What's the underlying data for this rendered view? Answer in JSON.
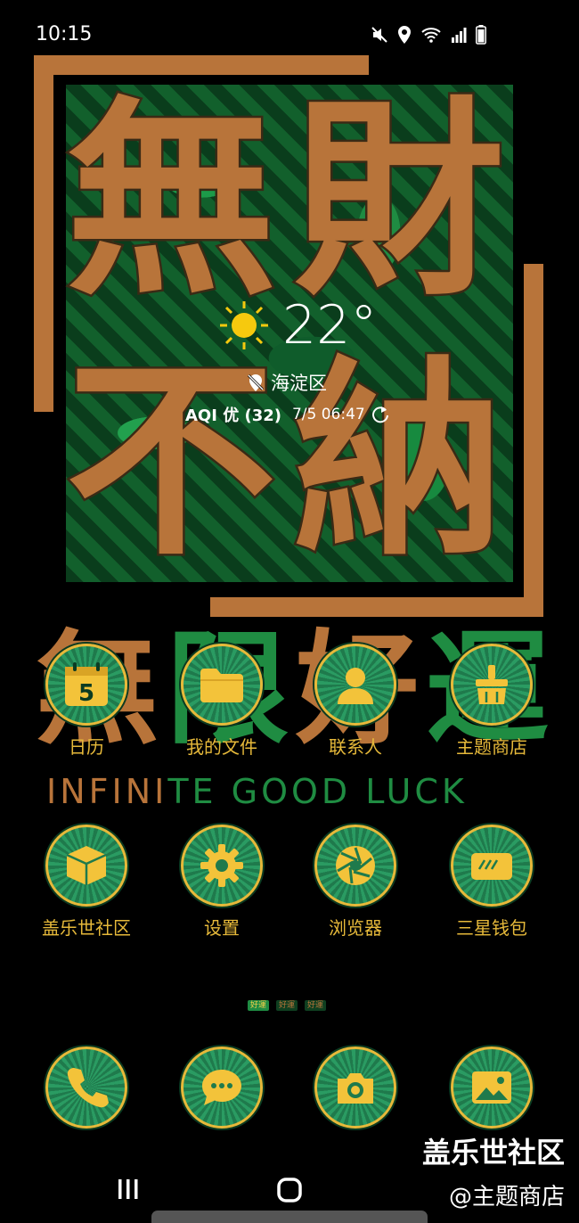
{
  "status_bar": {
    "time": "10:15",
    "icons": [
      "mute-icon",
      "location-icon",
      "wifi-icon",
      "signal-icon",
      "battery-icon"
    ]
  },
  "poster": {
    "chars": [
      "無",
      "財",
      "不",
      "納"
    ],
    "accent_color": "#b8743a",
    "leaf_color": "#1f8c42"
  },
  "weather": {
    "icon": "sun-icon",
    "temperature": "22°",
    "location": "海淀区",
    "aqi": "AQI 优 (32)",
    "updated": "7/5 06:47"
  },
  "background_text": {
    "chars": [
      "無",
      "限",
      "好",
      "運"
    ],
    "english_a": "INFINI",
    "english_b": "TE GOOD LUCK"
  },
  "apps_row1": [
    {
      "label": "日历",
      "icon": "calendar-icon",
      "badge": "5"
    },
    {
      "label": "我的文件",
      "icon": "folder-icon"
    },
    {
      "label": "联系人",
      "icon": "contact-icon"
    },
    {
      "label": "主题商店",
      "icon": "theme-store-icon"
    }
  ],
  "apps_row2": [
    {
      "label": "盖乐世社区",
      "icon": "box-icon"
    },
    {
      "label": "设置",
      "icon": "gear-icon"
    },
    {
      "label": "浏览器",
      "icon": "browser-icon"
    },
    {
      "label": "三星钱包",
      "icon": "wallet-icon"
    }
  ],
  "page_indicator": [
    "好運",
    "好運",
    "好運"
  ],
  "dock": [
    {
      "icon": "phone-icon"
    },
    {
      "icon": "messages-icon"
    },
    {
      "icon": "camera-icon"
    },
    {
      "icon": "gallery-icon"
    }
  ],
  "watermark": {
    "line1": "盖乐世社区",
    "line2": "@主题商店"
  },
  "navigation": [
    "recents-icon",
    "home-icon"
  ],
  "colors": {
    "label_gold": "#e6b93a",
    "icon_green": "#1f7a4c"
  }
}
